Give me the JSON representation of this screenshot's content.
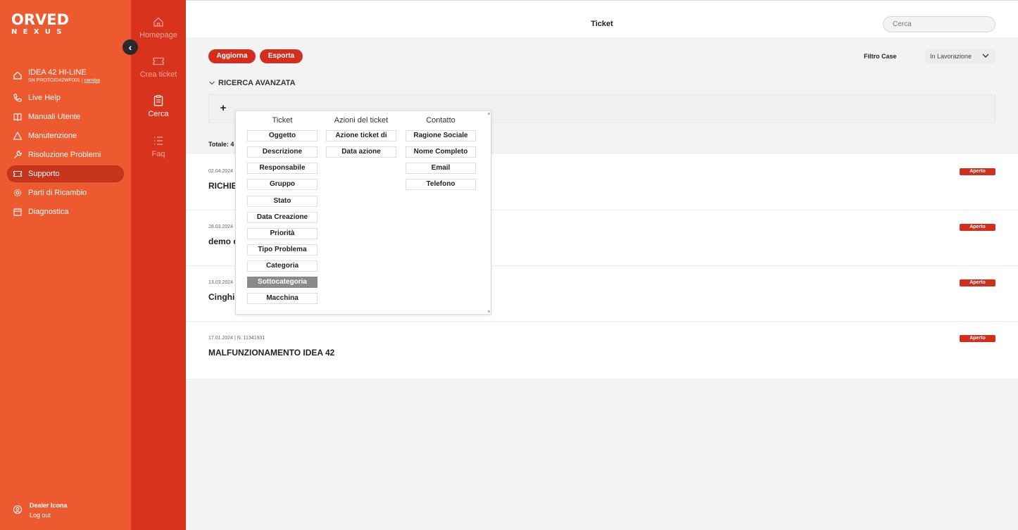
{
  "sidebar": {
    "logo_top": "ORVED",
    "logo_bottom": "NEXUS",
    "machine": {
      "name": "IDEA 42 HI-LINE",
      "serial": "SN PROTOID42WF001 | ",
      "change_label": "cambia"
    },
    "items": [
      {
        "label": "Live Help",
        "icon": "phone-icon"
      },
      {
        "label": "Manuali Utente",
        "icon": "book-icon"
      },
      {
        "label": "Manutenzione",
        "icon": "warning-icon"
      },
      {
        "label": "Risoluzione Problemi",
        "icon": "wrench-icon"
      },
      {
        "label": "Supporto",
        "icon": "ticket-icon",
        "active": true
      },
      {
        "label": "Parti di Ricambio",
        "icon": "gear-icon"
      },
      {
        "label": "Diagnostica",
        "icon": "calendar-icon"
      }
    ],
    "user": {
      "name": "Dealer Icona",
      "logout": "Log out"
    }
  },
  "rail": {
    "items": [
      {
        "label": "Homepage",
        "icon": "home-icon"
      },
      {
        "label": "Crea ticket",
        "icon": "ticket-icon"
      },
      {
        "label": "Cerca",
        "icon": "clipboard-icon",
        "active": true
      },
      {
        "label": "Faq",
        "icon": "list-icon"
      }
    ]
  },
  "header": {
    "title": "Ticket",
    "search_placeholder": "Cerca"
  },
  "toolbar": {
    "refresh_label": "Aggiorna",
    "export_label": "Esporta",
    "filter_label": "Filtro Case",
    "filter_value": "In Lavorazione"
  },
  "advanced_search": {
    "title": "RICERCA AVANZATA",
    "add_symbol": "+"
  },
  "total_label": "Totale: 4",
  "tickets": [
    {
      "meta": "02.04.2024",
      "subject": "RICHIE",
      "status": "Aperto"
    },
    {
      "meta": "28.03.2024",
      "subject": "demo c",
      "status": "Aperto"
    },
    {
      "meta": "13.03.2024",
      "subject": "Cinghi",
      "status": "Aperto"
    },
    {
      "meta": "17.01.2024 | N. 11341931",
      "subject": "MALFUNZIONAMENTO IDEA 42",
      "status": "Aperto"
    }
  ],
  "field_picker": {
    "columns": [
      {
        "title": "Ticket",
        "fields": [
          "Oggetto",
          "Descrizione",
          "Responsabile",
          "Gruppo",
          "Stato",
          "Data Creazione",
          "Priorità",
          "Tipo Problema",
          "Categoria",
          "Sottocategoria",
          "Macchina"
        ]
      },
      {
        "title": "Azioni del ticket",
        "fields": [
          "Azione ticket di",
          "Data azione"
        ]
      },
      {
        "title": "Contatto",
        "fields": [
          "Ragione Sociale",
          "Nome Completo",
          "Email",
          "Telefono"
        ]
      }
    ],
    "selected": "Sottocategoria"
  },
  "colors": {
    "sidebar": "#ee5a2f",
    "rail": "#d8341d",
    "accent": "#d22e1d",
    "active_nav": "#c4351b"
  }
}
